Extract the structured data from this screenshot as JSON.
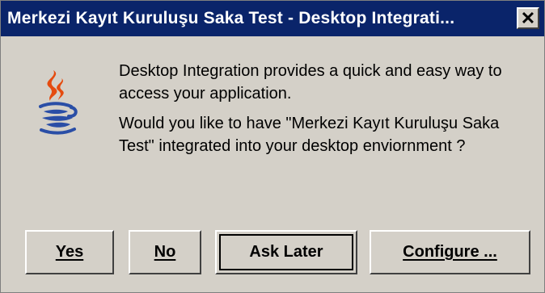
{
  "window": {
    "title": "Merkezi Kayıt Kuruluşu Saka Test - Desktop Integrati...",
    "close_icon": "close-icon"
  },
  "dialog": {
    "icon": "java-icon",
    "message_line1": "Desktop Integration provides a quick and easy way to access your application.",
    "message_line2": "Would you like to have  \"Merkezi Kayıt Kuruluşu Saka Test\" integrated into your desktop enviornment ?"
  },
  "buttons": {
    "yes_label": "Yes",
    "no_label": "No",
    "ask_later_label": "Ask Later",
    "configure_label": "Configure ..."
  },
  "colors": {
    "title_bar": "#0a246a",
    "window_bg": "#d4d0c8",
    "java_red": "#e54b0f",
    "java_blue": "#2a4ea6"
  }
}
